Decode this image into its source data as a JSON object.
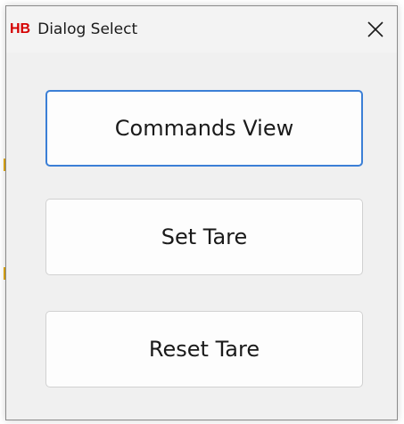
{
  "window": {
    "logo_text": "HB",
    "title": "Dialog Select",
    "close_icon": "close-icon"
  },
  "buttons": [
    {
      "label": "Commands View",
      "focused": true
    },
    {
      "label": "Set Tare",
      "focused": false
    },
    {
      "label": "Reset Tare",
      "focused": false
    }
  ],
  "colors": {
    "logo": "#d50000",
    "focus_border": "#3b7fd6",
    "dialog_bg": "#f0f0f0",
    "button_bg": "#fdfdfd"
  }
}
